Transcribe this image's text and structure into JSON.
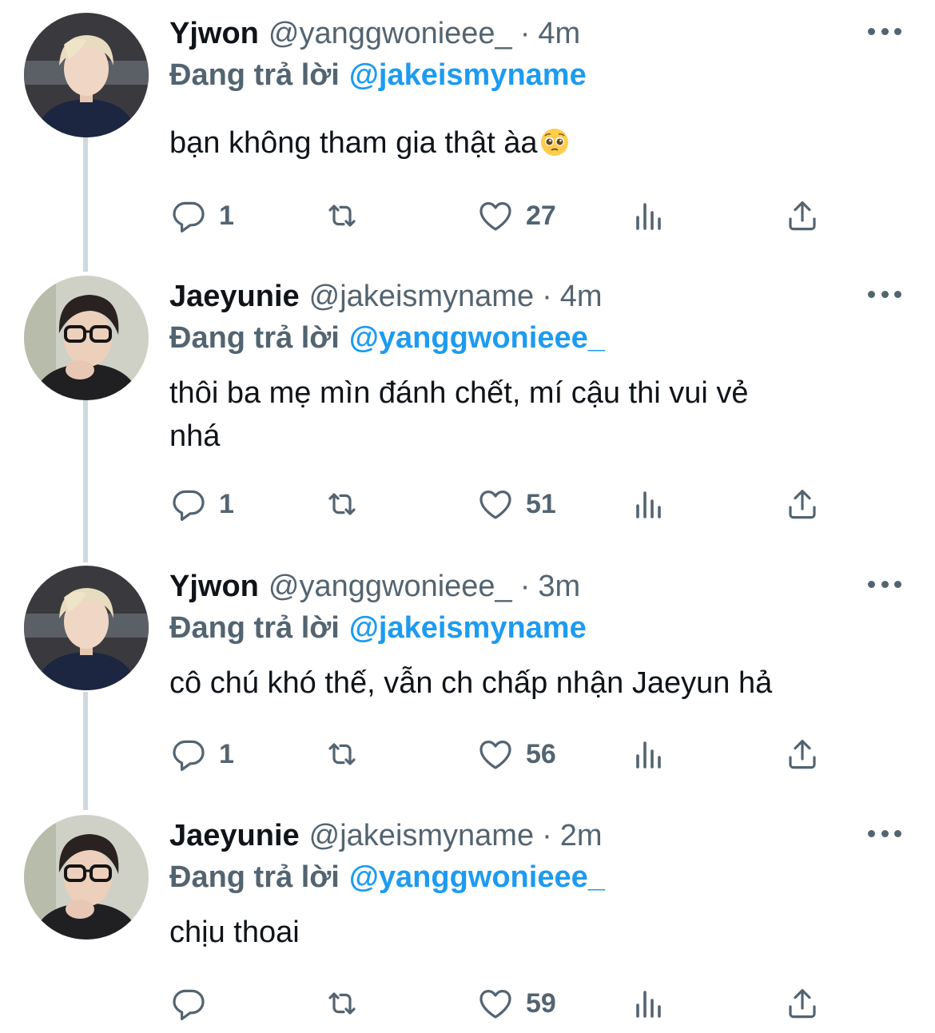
{
  "tweets": [
    {
      "display_name": "Yjwon",
      "handle": "@yanggwonieee_",
      "separator": "·",
      "time": "4m",
      "replying_label": "Đang trả lời",
      "replying_to": "@jakeismyname",
      "text": "bạn không tham gia thật àa",
      "emoji": "pleading-face-emoji",
      "reply_count": "1",
      "like_count": "27"
    },
    {
      "display_name": "Jaeyunie",
      "handle": "@jakeismyname",
      "separator": "·",
      "time": "4m",
      "replying_label": "Đang trả lời",
      "replying_to": "@yanggwonieee_",
      "text_line1": "thôi ba mẹ mìn đánh chết, mí cậu thi vui vẻ",
      "text_line2": "nhá",
      "reply_count": "1",
      "like_count": "51"
    },
    {
      "display_name": "Yjwon",
      "handle": "@yanggwonieee_",
      "separator": "·",
      "time": "3m",
      "replying_label": "Đang trả lời",
      "replying_to": "@jakeismyname",
      "text": "cô chú khó thế, vẫn ch chấp nhận Jaeyun hả",
      "reply_count": "1",
      "like_count": "56"
    },
    {
      "display_name": "Jaeyunie",
      "handle": "@jakeismyname",
      "separator": "·",
      "time": "2m",
      "replying_label": "Đang trả lời",
      "replying_to": "@yanggwonieee_",
      "text": "chịu thoai",
      "reply_count": "",
      "like_count": "59"
    }
  ],
  "colors": {
    "primary_text": "#0f1419",
    "secondary_text": "#536471",
    "link": "#1d9bf0",
    "thread_line": "#cfd9de"
  },
  "icons": [
    "reply-icon",
    "retweet-icon",
    "like-icon",
    "analytics-icon",
    "share-icon",
    "more-options-icon"
  ]
}
